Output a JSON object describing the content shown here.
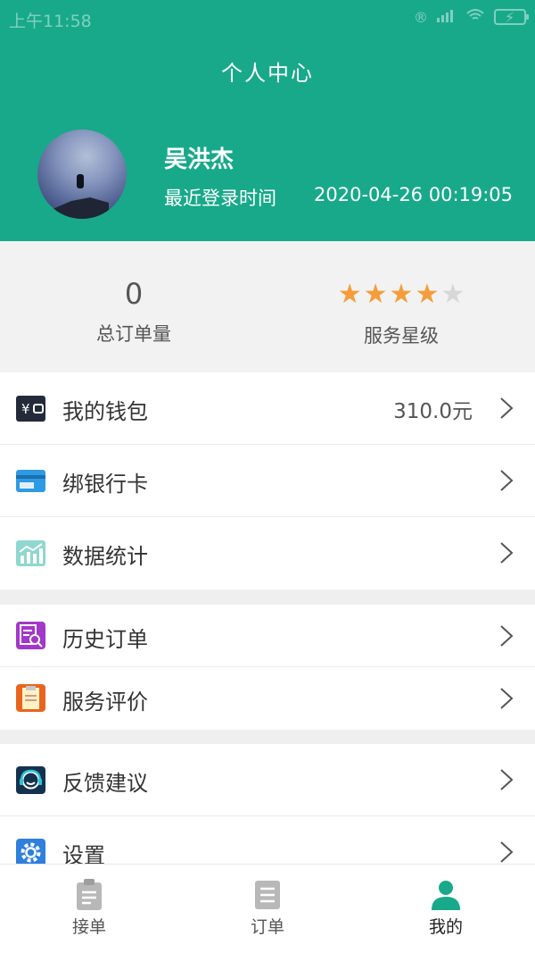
{
  "status_bar": {
    "time": "上午11:58"
  },
  "header": {
    "title": "个人中心"
  },
  "profile": {
    "name": "吴洪杰",
    "login_label": "最近登录时间",
    "login_time": "2020-04-26 00:19:05"
  },
  "stats": {
    "orders": {
      "value": "0",
      "label": "总订单量"
    },
    "rating": {
      "label": "服务星级",
      "stars": 4,
      "max_stars": 5
    }
  },
  "menu": {
    "wallet": {
      "label": "我的钱包",
      "value": "310.0元"
    },
    "bank_card": {
      "label": "绑银行卡"
    },
    "statistics": {
      "label": "数据统计"
    },
    "history": {
      "label": "历史订单"
    },
    "review": {
      "label": "服务评价"
    },
    "feedback": {
      "label": "反馈建议"
    },
    "settings": {
      "label": "设置"
    }
  },
  "tabbar": {
    "tabs": [
      {
        "label": "接单",
        "icon": "clipboard-icon"
      },
      {
        "label": "订单",
        "icon": "document-icon"
      },
      {
        "label": "我的",
        "icon": "person-icon"
      }
    ],
    "active_index": 2
  },
  "colors": {
    "brand": "#18a98a",
    "star_on": "#f59d3b",
    "star_off": "#d7d7d7"
  }
}
